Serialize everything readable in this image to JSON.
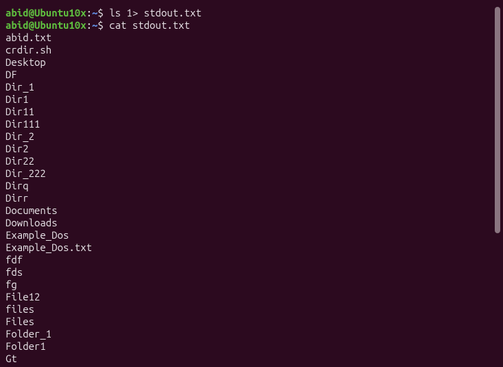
{
  "prompt1": {
    "user_host": "abid@Ubuntu10x",
    "separator": ":",
    "path": "~",
    "dollar": "$ ",
    "command": "ls 1> stdout.txt"
  },
  "prompt2": {
    "user_host": "abid@Ubuntu10x",
    "separator": ":",
    "path": "~",
    "dollar": "$ ",
    "command": "cat stdout.txt"
  },
  "output_lines": [
    "abid.txt",
    "crdir.sh",
    "Desktop",
    "DF",
    "Dir_1",
    "Dir1",
    "Dir11",
    "Dir111",
    "Dir_2",
    "Dir2",
    "Dir22",
    "Dir_222",
    "Dirq",
    "Dirr",
    "Documents",
    "Downloads",
    "Example_Dos",
    "Example_Dos.txt",
    "fdf",
    "fds",
    "fg",
    "File12",
    "files",
    "Files",
    "Folder_1",
    "Folder1",
    "Gt"
  ]
}
